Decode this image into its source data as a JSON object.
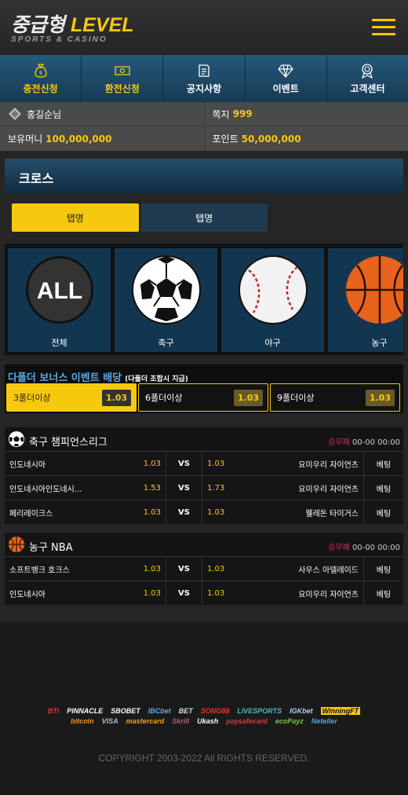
{
  "header": {
    "logo_korean": "중급형",
    "logo_level": "LEVEL",
    "logo_sub": "SPORTS & CASINO",
    "accent": "#f6c90e"
  },
  "nav": [
    {
      "label": "충전신청",
      "icon": "money-bag-icon",
      "active": true
    },
    {
      "label": "환전신청",
      "icon": "banknote-icon",
      "active": true
    },
    {
      "label": "공지사항",
      "icon": "notice-icon",
      "active": false
    },
    {
      "label": "이벤트",
      "icon": "diamond-icon",
      "active": false
    },
    {
      "label": "고객센터",
      "icon": "support-icon",
      "active": false
    }
  ],
  "user": {
    "name": "홍길순님",
    "message_label": "쪽지",
    "message_count": "999",
    "money_label": "보유머니",
    "money": "100,000,000",
    "point_label": "포인트",
    "point": "50,000,000"
  },
  "main": {
    "title": "크로스",
    "tabs": [
      "탭명",
      "탭명"
    ]
  },
  "categories": [
    {
      "label": "전체",
      "icon": "all-icon"
    },
    {
      "label": "축구",
      "icon": "soccer-ball-icon"
    },
    {
      "label": "야구",
      "icon": "baseball-icon"
    },
    {
      "label": "농구",
      "icon": "basketball-icon"
    }
  ],
  "bonus": {
    "title": "다폴더 보너스 이벤트 배당",
    "note": "(다폴더 조합시 지급)",
    "options": [
      {
        "label": "3폴더이상",
        "odds": "1.03",
        "selected": true
      },
      {
        "label": "6폴더이상",
        "odds": "1.03",
        "selected": false
      },
      {
        "label": "9폴더이상",
        "odds": "1.03",
        "selected": false
      }
    ]
  },
  "leagues": [
    {
      "name": "축구 챔피언스리그",
      "icon": "soccer-ball-icon",
      "market": "승무패",
      "time": "00-00 00:00",
      "matches": [
        {
          "home": "인도네시아",
          "home_odds": "1.03",
          "vs": "VS",
          "away_odds": "1.03",
          "away": "요미우리 자이언츠",
          "bet": "베팅"
        },
        {
          "home": "인도네시아인도네시...",
          "home_odds": "1.53",
          "vs": "VS",
          "away_odds": "1.73",
          "away": "요미우리 자이언츠",
          "bet": "베팅"
        },
        {
          "home": "페리레이크스",
          "home_odds": "1.03",
          "vs": "VS",
          "away_odds": "1.03",
          "away": "웰레돈 타이거스",
          "bet": "베팅"
        }
      ]
    },
    {
      "name": "농구 NBA",
      "icon": "basketball-icon",
      "market": "승무패",
      "time": "00-00 00:00",
      "matches": [
        {
          "home": "소프트뱅크 호크스",
          "home_odds": "1.03",
          "vs": "VS",
          "away_odds": "1.03",
          "away": "사우스 아델레이드",
          "bet": "베팅"
        },
        {
          "home": "인도네시아",
          "home_odds": "1.03",
          "vs": "VS",
          "away_odds": "1.03",
          "away": "요미우리 자이언츠",
          "bet": "베팅"
        }
      ]
    }
  ],
  "footer": {
    "brands": [
      "BTi",
      "PINNACLE",
      "SBOBET",
      "IBCbet",
      "BET",
      "SONG88",
      "LIVESPORTS",
      "IGKbet",
      "WinningFT",
      "bitcoin",
      "VISA",
      "mastercard",
      "Skrill",
      "Ukash",
      "paysafecard",
      "ecoPayz",
      "Neteller"
    ],
    "copyright": "COPYRIGHT 2003-2022 All RIGHTS RESERVED."
  }
}
